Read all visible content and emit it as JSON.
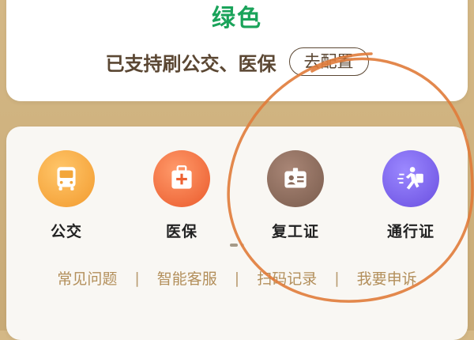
{
  "top": {
    "status_color_text": "绿色",
    "support_text": "已支持刷公交、医保",
    "config_button": "去配置"
  },
  "services": [
    {
      "label": "公交",
      "icon": "bus-icon",
      "color": "#f7a23b"
    },
    {
      "label": "医保",
      "icon": "medical-kit-icon",
      "color": "#ef6a3a"
    },
    {
      "label": "复工证",
      "icon": "id-card-icon",
      "color": "#8a6a5a"
    },
    {
      "label": "通行证",
      "icon": "runner-pass-icon",
      "color": "#7b63e8"
    }
  ],
  "links": {
    "faq": "常见问题",
    "support": "智能客服",
    "records": "扫码记录",
    "appeal": "我要申诉"
  },
  "colors": {
    "status_green": "#1aa35a",
    "brand_brown": "#5b4733",
    "link_gold": "#b38f5b",
    "annotation_orange": "#e07b3a"
  }
}
